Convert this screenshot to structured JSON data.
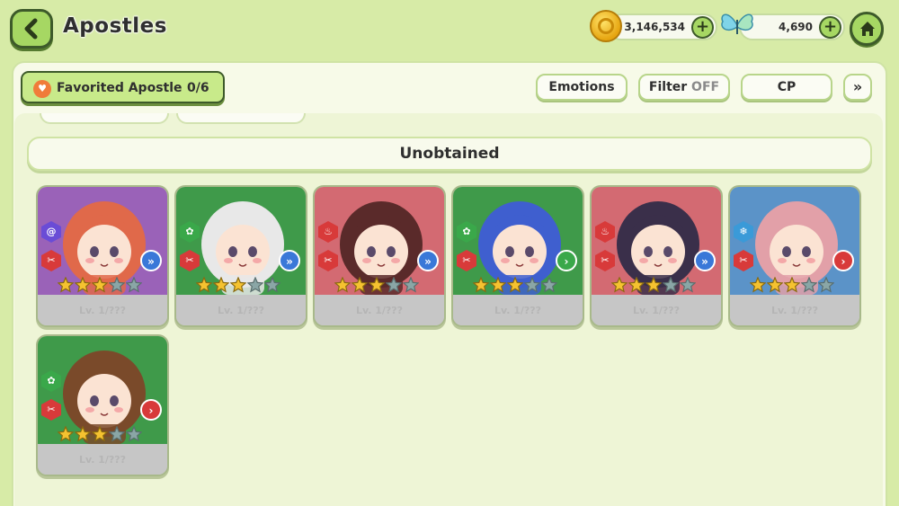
{
  "header": {
    "title": "Apostles",
    "gold": "3,146,534",
    "gems": "4,690"
  },
  "toolbar": {
    "favorited_label": "Favorited Apostle",
    "favorited_count": "0/6",
    "emotions_label": "Emotions",
    "filter_label": "Filter",
    "filter_state": "OFF",
    "sort_label": "CP"
  },
  "section": {
    "title": "Unobtained"
  },
  "colors": {
    "background": "#d7eba7",
    "accent_green": "#a6d763",
    "card_purple": "#9a62b8",
    "card_green": "#3f9a4a",
    "card_red": "#d36a72",
    "card_blue": "#5b93c8"
  },
  "apostles": [
    {
      "bg": "#9a62b8",
      "element": "wind-icon",
      "element_color": "#6a4cd6",
      "position": "back-icon",
      "position_color": "#3a78d8",
      "stars": 3,
      "name": "Lv. 1/???",
      "hair": "#e0694a"
    },
    {
      "bg": "#3f9a4a",
      "element": "earth-icon",
      "element_color": "#3aa84a",
      "position": "back-icon",
      "position_color": "#3a78d8",
      "stars": 3,
      "name": "Lv. 1/???",
      "hair": "#e8e8e8"
    },
    {
      "bg": "#d36a72",
      "element": "fire-icon",
      "element_color": "#d83a3a",
      "position": "back-icon",
      "position_color": "#3a78d8",
      "stars": 3,
      "name": "Lv. 1/???",
      "hair": "#5a2a2a"
    },
    {
      "bg": "#3f9a4a",
      "element": "earth-icon",
      "element_color": "#3aa84a",
      "position": "mid-icon",
      "position_color": "#3aa84a",
      "stars": 3,
      "name": "Lv. 1/???",
      "hair": "#3f5fcf"
    },
    {
      "bg": "#d36a72",
      "element": "fire-icon",
      "element_color": "#d83a3a",
      "position": "back-icon",
      "position_color": "#3a78d8",
      "stars": 3,
      "name": "Lv. 1/???",
      "hair": "#3a2f4a"
    },
    {
      "bg": "#5b93c8",
      "element": "ice-icon",
      "element_color": "#3a9ad8",
      "position": "front-icon",
      "position_color": "#d83a3a",
      "stars": 3,
      "name": "Lv. 1/???",
      "hair": "#e2a0a8"
    },
    {
      "bg": "#3f9a4a",
      "element": "earth-icon",
      "element_color": "#3aa84a",
      "position": "front-icon",
      "position_color": "#d83a3a",
      "stars": 3,
      "name": "Lv. 1/???",
      "hair": "#7a4a2a"
    }
  ]
}
